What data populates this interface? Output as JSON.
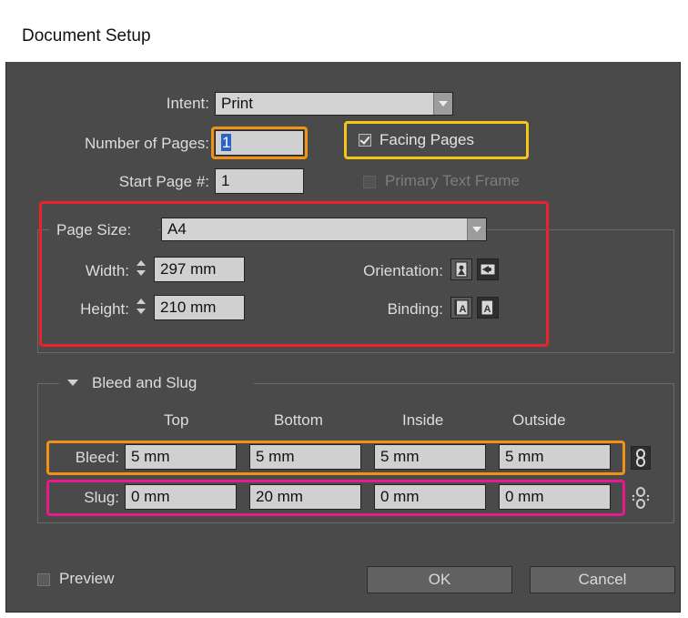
{
  "window": {
    "title": "Document Setup"
  },
  "intent": {
    "label": "Intent:",
    "value": "Print"
  },
  "number_of_pages": {
    "label": "Number of Pages:",
    "value": "1"
  },
  "start_page": {
    "label": "Start Page #:",
    "value": "1"
  },
  "facing_pages": {
    "label": "Facing Pages",
    "checked": true
  },
  "primary_text_frame": {
    "label": "Primary Text Frame",
    "checked": false,
    "enabled": false
  },
  "page_size": {
    "label": "Page Size:",
    "value": "A4",
    "width_label": "Width:",
    "width_value": "297 mm",
    "height_label": "Height:",
    "height_value": "210 mm",
    "orientation_label": "Orientation:",
    "binding_label": "Binding:",
    "orientation_selected": "landscape",
    "binding_selected": "right-to-left"
  },
  "bleed_slug": {
    "section_label": "Bleed and Slug",
    "columns": [
      "Top",
      "Bottom",
      "Inside",
      "Outside"
    ],
    "bleed_label": "Bleed:",
    "bleed_values": [
      "5 mm",
      "5 mm",
      "5 mm",
      "5 mm"
    ],
    "slug_label": "Slug:",
    "slug_values": [
      "0 mm",
      "20 mm",
      "0 mm",
      "0 mm"
    ]
  },
  "footer": {
    "preview_label": "Preview",
    "ok_label": "OK",
    "cancel_label": "Cancel"
  },
  "colors": {
    "dialog_bg": "#4a4a4a",
    "highlight_red": "#e8232d",
    "highlight_yellow": "#f7c518",
    "highlight_orange": "#f19214",
    "highlight_pink": "#e8198b"
  }
}
